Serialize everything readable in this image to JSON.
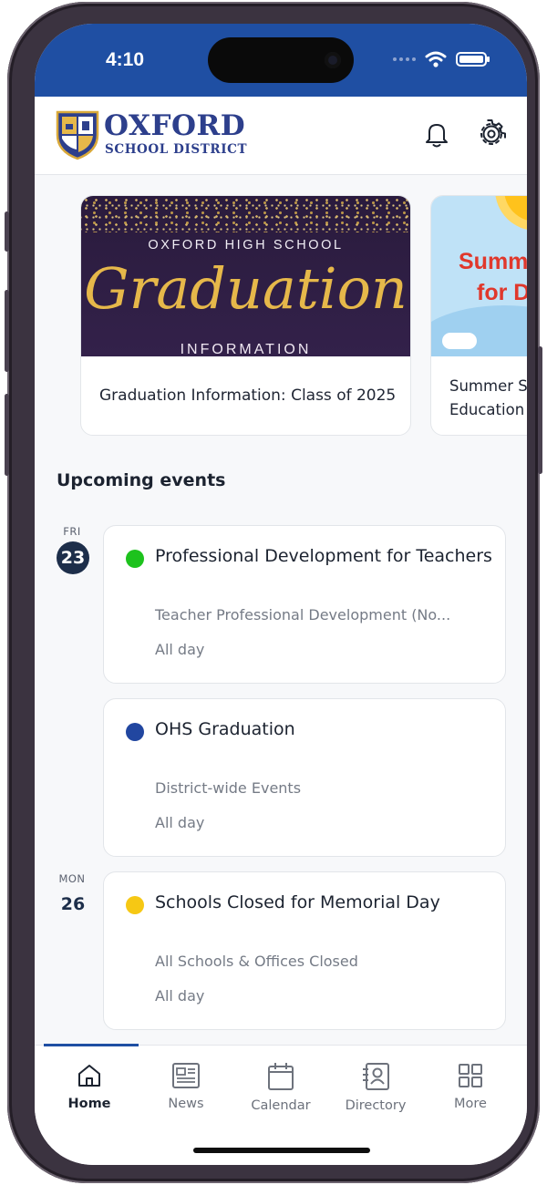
{
  "status_bar": {
    "time": "4:10"
  },
  "header": {
    "logo": {
      "title": "OXFORD",
      "subtitle": "SCHOOL DISTRICT"
    },
    "icons": [
      "bell-icon",
      "gear-icon"
    ]
  },
  "carousel": [
    {
      "banner": {
        "line1": "OXFORD HIGH SCHOOL",
        "line2": "Graduation",
        "line3": "INFORMATION"
      },
      "title": "Graduation Information: Class of 2025"
    },
    {
      "banner": {
        "line1": "Summ",
        "line2": "for D"
      },
      "title": "Summer Se\nEducation"
    }
  ],
  "events_section": {
    "title": "Upcoming events",
    "days": [
      {
        "weekday": "FRI",
        "date": "23"
      },
      {
        "weekday": "MON",
        "date": "26"
      }
    ],
    "events": [
      {
        "title": "Professional Development for Teachers",
        "calendar": "Teacher Professional Development (No...",
        "time": "All day",
        "color": "#1dc21d"
      },
      {
        "title": "OHS Graduation",
        "calendar": "District-wide Events",
        "time": "All day",
        "color": "#2146a0"
      },
      {
        "title": "Schools Closed for Memorial Day",
        "calendar": "All Schools & Offices Closed",
        "time": "All day",
        "color": "#f6c814"
      }
    ]
  },
  "tabbar": {
    "tabs": [
      {
        "label": "Home",
        "icon": "home-icon",
        "active": true
      },
      {
        "label": "News",
        "icon": "news-icon",
        "active": false
      },
      {
        "label": "Calendar",
        "icon": "calendar-icon",
        "active": false
      },
      {
        "label": "Directory",
        "icon": "directory-icon",
        "active": false
      },
      {
        "label": "More",
        "icon": "grid-icon",
        "active": false
      }
    ]
  },
  "colors": {
    "brand": "#1f4fa3",
    "logo": "#2d3f8c",
    "date_badge": "#1d2e4a"
  }
}
